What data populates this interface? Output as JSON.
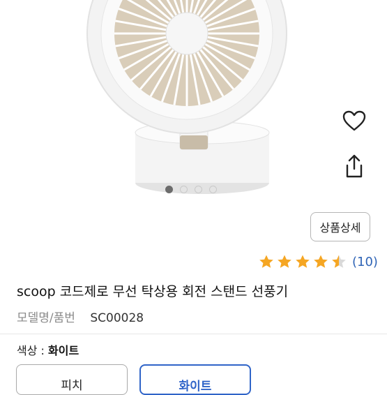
{
  "product": {
    "title": "scoop 코드제로 무선 탁상용 회전 스탠드 선풍기",
    "model_label": "모델명/품번",
    "model_value": "SC00028"
  },
  "gallery": {
    "image_count": 4,
    "active_index": 0
  },
  "actions": {
    "favorite_icon": "heart-icon",
    "share_icon": "share-icon",
    "detail_button": "상품상세"
  },
  "rating": {
    "stars": 4.5,
    "max": 5,
    "review_count": "(10)",
    "star_color": "#f5a623"
  },
  "option": {
    "label": "색상 : ",
    "selected": "화이트",
    "choices": [
      "피치",
      "화이트"
    ]
  },
  "colors": {
    "accent": "#2f64c8",
    "link": "#2f64b6"
  }
}
